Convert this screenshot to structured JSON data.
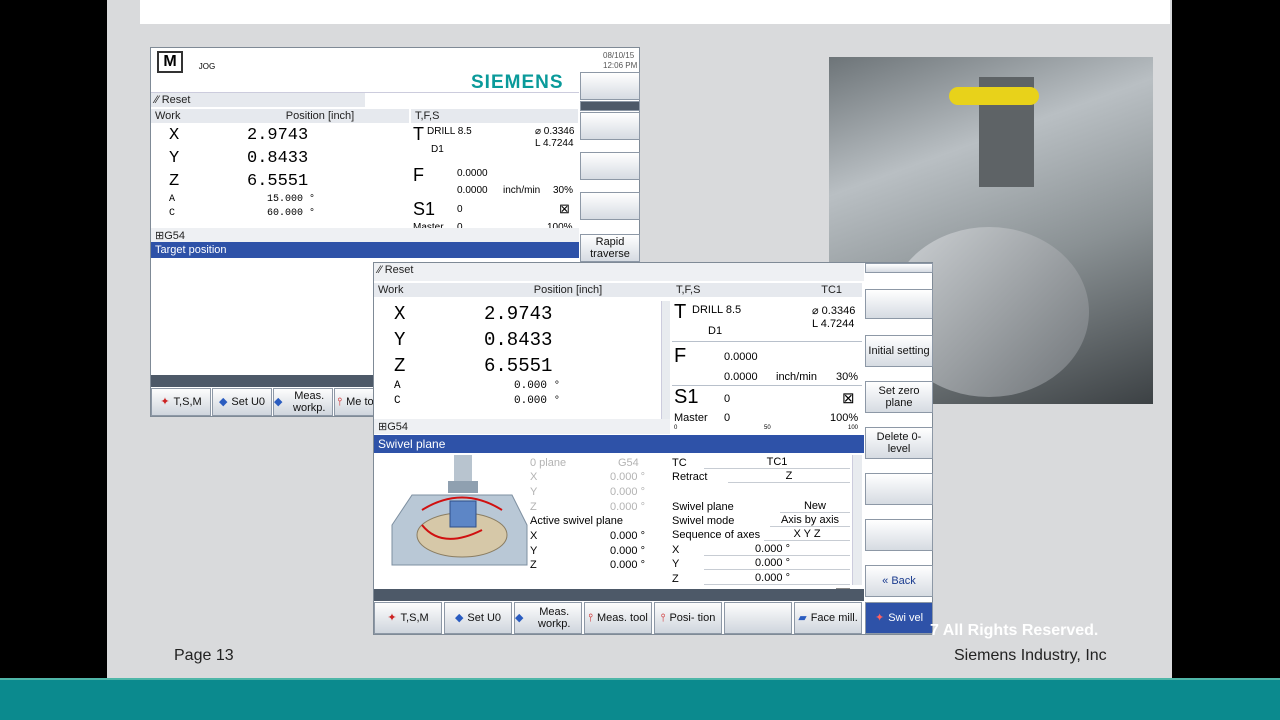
{
  "footer": {
    "page": "Page 13",
    "company": "Siemens Industry, Inc",
    "rights": "7  All Rights Reserved."
  },
  "back": {
    "mode_icon": "M",
    "jog": "JOG",
    "date": "08/10/15",
    "time": "12:06 PM",
    "brand": "SIEMENS",
    "status": "Reset",
    "col_work": "Work",
    "col_pos": "Position [inch]",
    "col_tfs": "T,F,S",
    "axes": [
      {
        "n": "X",
        "v": "2.9743"
      },
      {
        "n": "Y",
        "v": "0.8433"
      },
      {
        "n": "Z",
        "v": "6.5551"
      }
    ],
    "rot": [
      {
        "n": "A",
        "v": "15.000 °"
      },
      {
        "n": "C",
        "v": "60.000 °"
      }
    ],
    "tool": "DRILL 8.5",
    "d": "D1",
    "dia": "⌀ 0.3346",
    "len": "L 4.7244",
    "f1": "0.0000",
    "f2": "0.0000",
    "funit": "inch/min",
    "fpct": "30%",
    "s_val": "0",
    "master": "Master",
    "master_val": "0",
    "spct": "100%",
    "g54": "G54",
    "target": "Target position",
    "rapid": "Rapid traverse",
    "softkeys": [
      "T,S,M",
      "Set U0",
      "Meas. workp.",
      "Me to"
    ]
  },
  "front": {
    "status": "Reset",
    "col_work": "Work",
    "col_pos": "Position [inch]",
    "col_tfs": "T,F,S",
    "tc": "TC1",
    "axes": [
      {
        "n": "X",
        "v": "2.9743"
      },
      {
        "n": "Y",
        "v": "0.8433"
      },
      {
        "n": "Z",
        "v": "6.5551"
      }
    ],
    "rot": [
      {
        "n": "A",
        "v": "0.000 °"
      },
      {
        "n": "C",
        "v": "0.000 °"
      }
    ],
    "tool": "DRILL 8.5",
    "d": "D1",
    "dia": "⌀ 0.3346",
    "len": "L 4.7244",
    "f1": "0.0000",
    "f2": "0.0000",
    "funit": "inch/min",
    "fpct": "30%",
    "s_val": "0",
    "master": "Master",
    "master_val": "0",
    "spct": "100%",
    "bar0": "0",
    "bar50": "50",
    "bar100": "100",
    "g54": "G54",
    "section": "Swivel plane",
    "grey": {
      "plane": "0 plane",
      "g": "G54",
      "rows": [
        {
          "n": "X",
          "v": "0.000 °"
        },
        {
          "n": "Y",
          "v": "0.000 °"
        },
        {
          "n": "Z",
          "v": "0.000 °"
        }
      ]
    },
    "active": {
      "title": "Active swivel plane",
      "rows": [
        {
          "n": "X",
          "v": "0.000 °"
        },
        {
          "n": "Y",
          "v": "0.000 °"
        },
        {
          "n": "Z",
          "v": "0.000 °"
        }
      ]
    },
    "form": {
      "tc_label": "TC",
      "tc_val": "TC1",
      "retract_label": "Retract",
      "retract_val": "Z",
      "sp_label": "Swivel plane",
      "sp_val": "New",
      "mode_label": "Swivel mode",
      "mode_val": "Axis by axis",
      "seq_label": "Sequence of axes",
      "seq_val": "X Y Z",
      "rows": [
        {
          "n": "X",
          "v": "0.000 °"
        },
        {
          "n": "Y",
          "v": "0.000 °"
        },
        {
          "n": "Z",
          "v": "0.000 °"
        }
      ]
    },
    "vsoft": [
      "Initial setting",
      "Set zero plane",
      "Delete 0-level",
      "",
      "",
      "« Back"
    ],
    "hsoft": [
      "T,S,M",
      "Set U0",
      "Meas. workp.",
      "Meas. tool",
      "Posi- tion",
      "",
      "Face mill.",
      "Swi vel"
    ]
  }
}
